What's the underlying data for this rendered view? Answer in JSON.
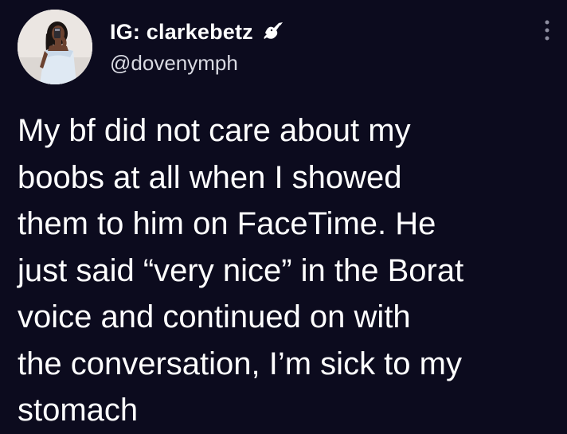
{
  "tweet": {
    "display_name": "IG: clarkebetz",
    "name_badge_icon": "dove-icon",
    "handle": "@dovenymph",
    "more_icon": "vertical-ellipsis-icon",
    "avatar": "profile-photo",
    "text_lines": [
      "My bf did not care about my",
      "boobs at all when I showed",
      "them to him on FaceTime. He",
      "just said “very nice” in the Borat",
      "voice and continued on with",
      "the conversation, I’m sick to my",
      "stomach"
    ]
  },
  "colors": {
    "background": "#0c0b1e",
    "text_primary": "#ffffff",
    "text_secondary": "#d9dae2"
  }
}
